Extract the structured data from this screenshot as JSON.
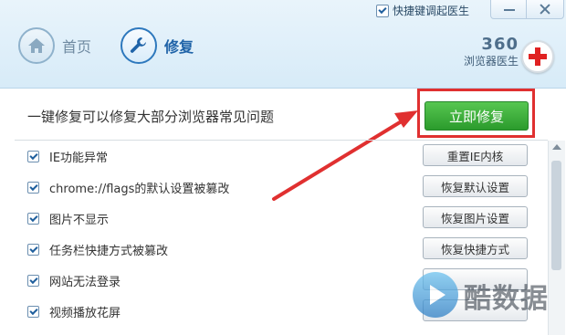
{
  "header": {
    "shortcut_label": "快捷键调起医生",
    "shortcut_checked": true,
    "nav": {
      "home_label": "首页",
      "repair_label": "修复"
    },
    "brand": {
      "number": "360",
      "name": "浏览器医生"
    }
  },
  "main": {
    "headline": "一键修复可以修复大部分浏览器常见问题",
    "repair_now_label": "立即修复",
    "accent_color": "#e03030",
    "button_color": "#3aad3a"
  },
  "items": [
    {
      "label": "IE功能异常",
      "action": "重置IE内核",
      "checked": true
    },
    {
      "label": "chrome://flags的默认设置被篡改",
      "action": "恢复默认设置",
      "checked": true
    },
    {
      "label": "图片不显示",
      "action": "恢复图片设置",
      "checked": true
    },
    {
      "label": "任务栏快捷方式被篡改",
      "action": "恢复快捷方式",
      "checked": true
    },
    {
      "label": "网站无法登录",
      "action": "",
      "checked": true
    },
    {
      "label": "视频播放花屏",
      "action": "",
      "checked": true
    }
  ],
  "watermark": {
    "text": "酷数据"
  }
}
